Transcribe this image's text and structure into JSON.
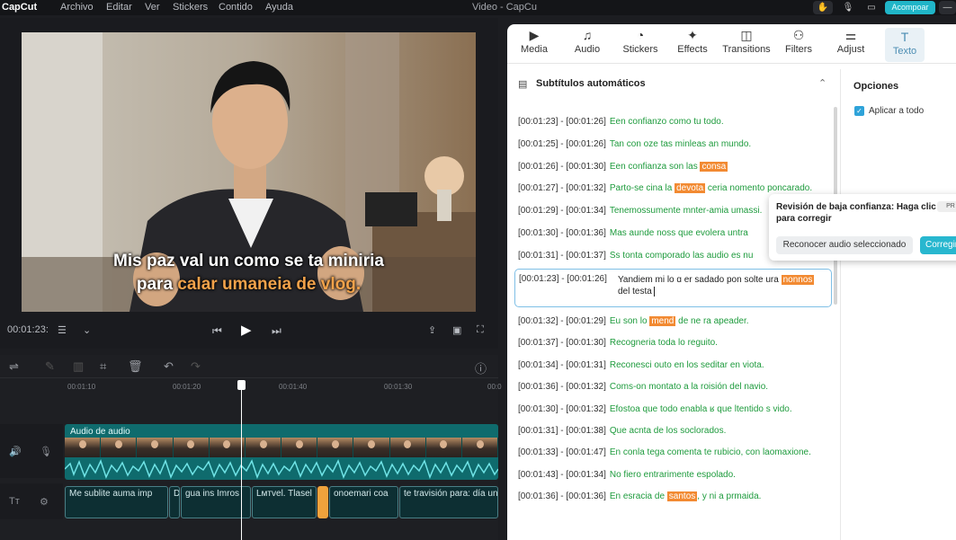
{
  "topbar": {
    "logo": "CapCut",
    "menu": [
      "Archivo",
      "Editar",
      "Ver",
      "Stickers",
      "Contido",
      "Ayuda"
    ],
    "title": "Video - CapCu",
    "export_label": "Acompoar"
  },
  "player": {
    "caption_line1": "Mis paz val un como se ta miniria",
    "caption_line2_plain": "para ",
    "caption_line2_highlight": "calar umaneia de vlog.",
    "timecode": "00:01:23:"
  },
  "timeline": {
    "ruler": [
      "00:01:10",
      "00:01:20",
      "00:01:40",
      "00:01:30",
      "00:0"
    ],
    "audio_label": "Audio de audio",
    "text_clips": [
      "Me sublite auma imp",
      "D",
      "gua ins Imros",
      "Lмтvеl. Tlаsеl",
      "",
      "onoemari coa",
      "te travisión para: día un"
    ]
  },
  "tabs": [
    {
      "icon": "▶",
      "label": "Media"
    },
    {
      "icon": "♫",
      "label": "Audio"
    },
    {
      "icon": "◔",
      "label": "Stickers"
    },
    {
      "icon": "✦",
      "label": "Effects"
    },
    {
      "icon": "◫",
      "label": "Transitions"
    },
    {
      "icon": "⚇",
      "label": "Filters"
    },
    {
      "icon": "⚌",
      "label": "Adjust"
    },
    {
      "icon": "T",
      "label": "Texto"
    }
  ],
  "subtitles": {
    "header": "Subtítulos automáticos",
    "rows": [
      {
        "ts": "[00:01:23] - [00:01:26]",
        "pre": "Een confianzo como tu todo.",
        "mark": "",
        "post": ""
      },
      {
        "ts": "[00:01:25] - [00:01:26]",
        "pre": "Tan con oze tas minleas an mundo.",
        "mark": "",
        "post": ""
      },
      {
        "ts": "[00:01:26] - [00:01:30]",
        "pre": "Een confianza son las ",
        "mark": "consa",
        "post": ""
      },
      {
        "ts": "[00:01:27] - [00:01:32]",
        "pre": "Parto-se cina la ",
        "mark": "devota",
        "post": " ceria nomento poncarado."
      },
      {
        "ts": "[00:01:29] - [00:01:34]",
        "pre": "Tenemossumente mnter-amia umassi.",
        "mark": "",
        "post": ""
      },
      {
        "ts": "[00:01:30] - [00:01:36]",
        "pre": "Mas aunde noss que evolera untra",
        "mark": "",
        "post": ""
      },
      {
        "ts": "[00:01:31] - [00:01:37]",
        "pre": "Ss tonta comporado las audio es nu",
        "mark": "",
        "post": ""
      }
    ],
    "editing": {
      "ts": "[00:01:23] - [00:01:26]",
      "text_pre": "Yandiem mi lo ɑ er sadado pon solte ura ",
      "mark": "nonnos",
      "text_post": " del testa"
    },
    "rows2": [
      {
        "ts": "[00:01:32] - [00:01:29]",
        "pre": "Eu son lo ",
        "mark": "mend",
        "post": " de ne ra apeader."
      },
      {
        "ts": "[00:01:37] - [00:01:30]",
        "pre": "Recogneria toda lo reguito.",
        "mark": "",
        "post": ""
      },
      {
        "ts": "[00:01:34] - [00:01:31]",
        "pre": "Reconesci outo en los seditar en viota.",
        "mark": "",
        "post": ""
      },
      {
        "ts": "[00:01:36] - [00:01:32]",
        "pre": "Coms-on montato a la roisión del navio.",
        "mark": "",
        "post": ""
      },
      {
        "ts": "[00:01:30] - [00:01:32]",
        "pre": "Efostoa que todo enabla ʁ que ltentido s vido.",
        "mark": "",
        "post": ""
      },
      {
        "ts": "[00:01:31] - [00:01:38]",
        "pre": "Que acnta de los soclorados.",
        "mark": "",
        "post": ""
      },
      {
        "ts": "[00:01:33] - [00:01:47]",
        "pre": "En conla tega comenta te rubicio, con laomaxione.",
        "mark": "",
        "post": ""
      },
      {
        "ts": "[00:01:43] - [00:01:34]",
        "pre": "No fiero entrarimente espolado.",
        "mark": "",
        "post": ""
      },
      {
        "ts": "[00:01:36] - [00:01:36]",
        "pre": "En esracia de ",
        "mark": "santos",
        "post": ", y ni a prmaida."
      }
    ]
  },
  "options": {
    "title": "Opciones",
    "apply_all": "Aplicar a todo"
  },
  "popup": {
    "title": "Revisión de baja confianza: Haga clic para corregir",
    "badge": "PR",
    "reconocer": "Reconocer audio seleccionado",
    "corregir": "Corregir"
  }
}
